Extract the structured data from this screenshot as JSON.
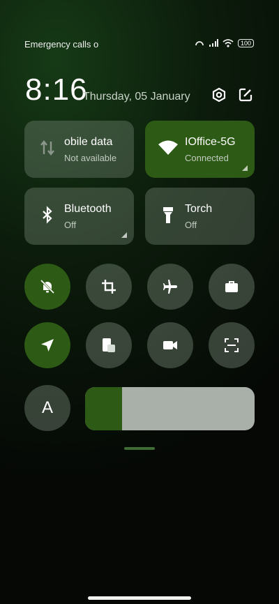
{
  "status_bar": {
    "carrier": "Emergency calls o",
    "battery": "100"
  },
  "header": {
    "time": "8:16",
    "date": "Thursday, 05 January"
  },
  "tiles": [
    {
      "label": "obile data",
      "sub": "Not available"
    },
    {
      "label": "IOffice-5G",
      "sub": "Connected"
    },
    {
      "label": "Bluetooth",
      "sub": "Off"
    },
    {
      "label": "Torch",
      "sub": "Off"
    }
  ],
  "font_button": {
    "label": "A"
  },
  "brightness": {
    "level": 0.22
  },
  "colors": {
    "accent": "#2d5a14",
    "tile": "#5e6b5e",
    "slider_track": "#a9b0aa"
  }
}
